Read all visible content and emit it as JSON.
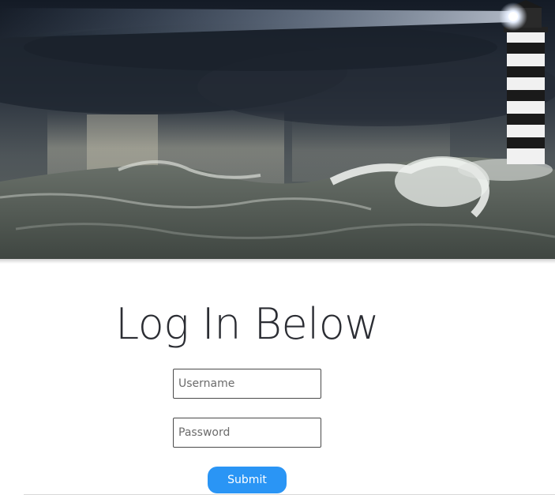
{
  "hero": {
    "image_name": "stormy-sea-lighthouse"
  },
  "login": {
    "title": "Log In Below",
    "username_placeholder": "Username",
    "password_placeholder": "Password",
    "submit_label": "Submit"
  },
  "colors": {
    "submit_button": "#2a95f5",
    "title_text": "#2b2d33",
    "field_border": "#4a4a4a"
  }
}
